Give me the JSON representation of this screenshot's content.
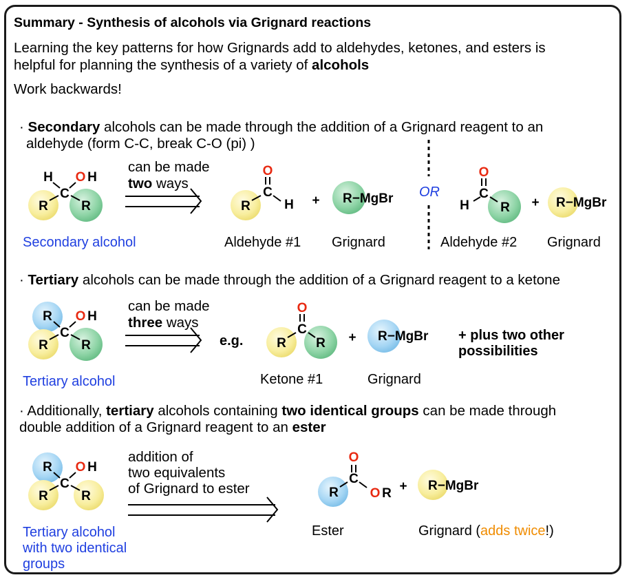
{
  "title": "Summary - Synthesis of alcohols via Grignard reactions",
  "intro": {
    "line1": "Learning the key  patterns for how Grignards add to aldehydes, ketones, and esters is",
    "line2_prefix": "helpful for planning the synthesis of a variety of ",
    "line2_bold": "alcohols",
    "line3": "Work backwards!"
  },
  "section_secondary": {
    "bullet": "·",
    "bold": "Secondary",
    "text1": " alcohols can be made through the addition of a Grignard reagent to an",
    "text2": "aldehyde (form C-C, break C-O (pi) )",
    "arrow_line1": "can be made",
    "arrow_bold": "two",
    "arrow_rest": " ways",
    "product_label": "Secondary alcohol",
    "reactant1_label": "Aldehyde #1",
    "reagent1_label": "Grignard",
    "or_label": "OR",
    "reactant2_label": "Aldehyde #2",
    "reagent2_label": "Grignard",
    "plus": "+",
    "grignard_formula": "R−MgBr"
  },
  "section_tertiary": {
    "bullet": "·",
    "bold": "Tertiary",
    "text1": " alcohols can be made through the addition of a Grignard reagent to a ketone",
    "arrow_line1": "can be made",
    "arrow_bold": "three",
    "arrow_rest": " ways",
    "eg": "e.g.",
    "product_label": "Tertiary alcohol",
    "reactant_label": "Ketone #1",
    "reagent_label": "Grignard",
    "plus": "+",
    "grignard_formula": "R−MgBr",
    "other1": "+ plus two other",
    "other2": "possibilities"
  },
  "section_ester": {
    "bullet": "·",
    "text_a": " Additionally, ",
    "bold1": "tertiary",
    "text_b": " alcohols containing ",
    "bold2": "two identical groups",
    "text_c": " can be made through",
    "text2_prefix": "double addition of a Grignard reagent to an ",
    "bold3": "ester",
    "arrow_line1": "addition of",
    "arrow_line2": "two equivalents",
    "arrow_line3": "of Grignard to ester",
    "product_label1": "Tertiary alcohol",
    "product_label2": "with two identical",
    "product_label3": "groups",
    "reactant_label": "Ester",
    "reagent_label_prefix": "Grignard (",
    "reagent_label_highlight": "adds twice",
    "reagent_label_suffix": "!)",
    "plus": "+",
    "grignard_formula": "R−MgBr"
  },
  "atoms": {
    "R": "R",
    "C": "C",
    "O": "O",
    "H": "H",
    "OH_O": "O",
    "OH_H": "H",
    "OR_O": "O",
    "OR_R": "R",
    "MgBr": "MgBr",
    "dash": "−"
  },
  "colors": {
    "yellow_sphere": "#f6ec9c",
    "green_sphere": "#86d0a2",
    "blue_sphere": "#9fd2f2",
    "oxygen_red": "#e82a12",
    "label_blue": "#1f3fe0",
    "highlight_orange": "#f08c00"
  }
}
